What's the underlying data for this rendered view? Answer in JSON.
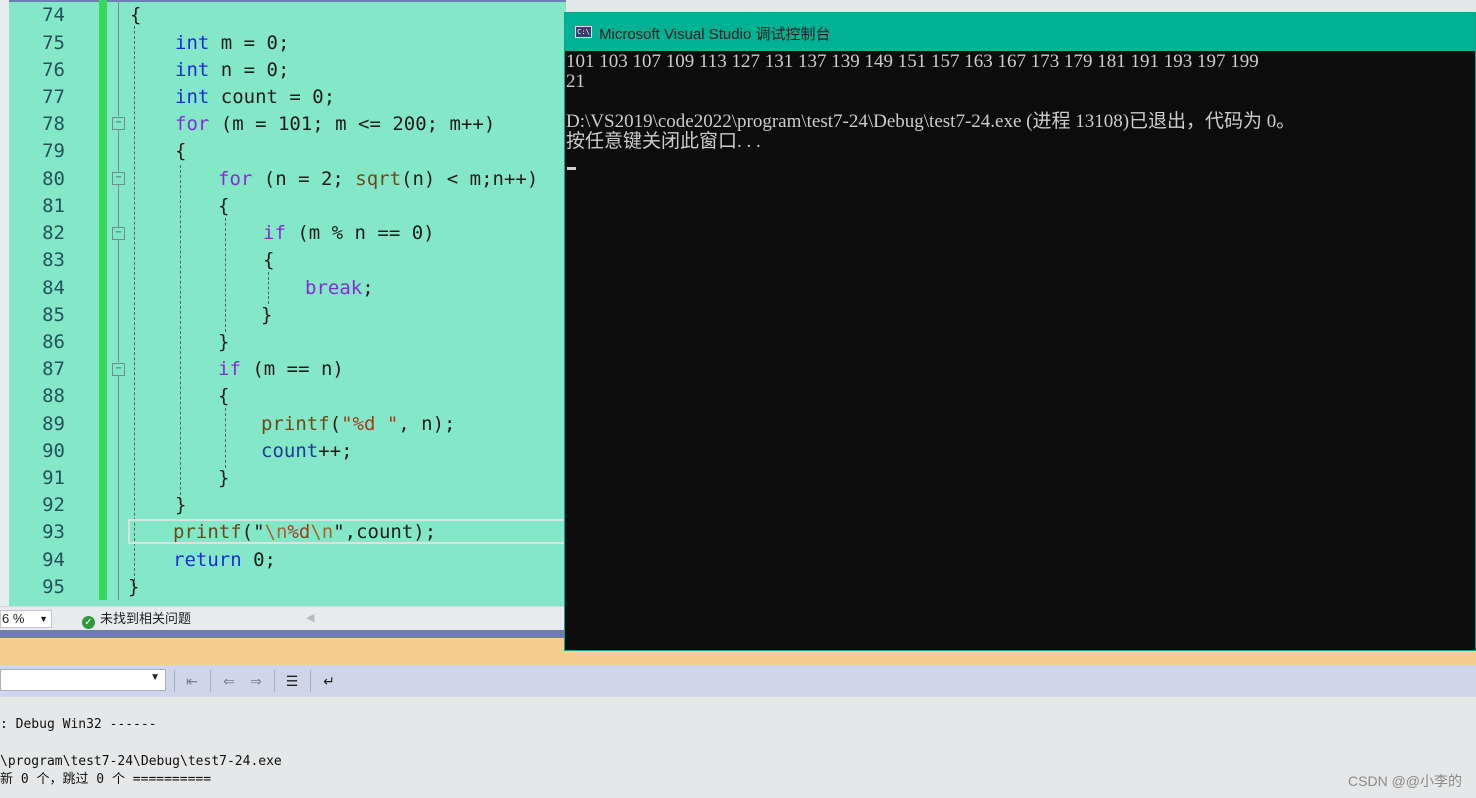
{
  "editor": {
    "line_numbers": [
      "74",
      "75",
      "76",
      "77",
      "78",
      "79",
      "80",
      "81",
      "82",
      "83",
      "84",
      "85",
      "86",
      "87",
      "88",
      "89",
      "90",
      "91",
      "92",
      "93",
      "94",
      "95"
    ],
    "code": {
      "l74": "{",
      "kw_int": "int",
      "l75_rest": " m = 0;",
      "l76_rest": " n = 0;",
      "l77_rest": " count = 0;",
      "kw_for": "for",
      "l78_rest": " (m = 101; m <= 200; m++)",
      "l79": "{",
      "l80_open": " (n = 2; ",
      "fn_sqrt": "sqrt",
      "l80_close": "(n) < m;n++)",
      "l81": "{",
      "kw_if": "if",
      "l82_rest": " (m % n == 0)",
      "l83": "{",
      "kw_break": "break",
      "semi": ";",
      "l85": "}",
      "l86": "}",
      "l87_rest": " (m == n)",
      "l88": "{",
      "fn_printf": "printf",
      "l89_open": "(",
      "l89_str": "\"%d \"",
      "l89_close": ", n);",
      "var_count": "count",
      "l90_rest": "++;",
      "l91": "}",
      "l92": "}",
      "l93_open": "(\"",
      "esc_n1": "\\n",
      "l93_mid": "%d",
      "esc_n2": "\\n",
      "l93_close": "\",count);",
      "kw_return": "return",
      "l94_rest": " 0;",
      "l95": "}"
    },
    "fold_markers": [
      "−",
      "−",
      "−",
      "−"
    ]
  },
  "status_bar": {
    "zoom": "6 %",
    "issues_text": "未找到相关问题",
    "issues_icon": "check-circle-icon"
  },
  "output": {
    "lines": [
      ": Debug Win32 ------",
      "\\program\\test7-24\\Debug\\test7-24.exe",
      "新 0 个，跳过 0 个 =========="
    ]
  },
  "console": {
    "title": "Microsoft Visual Studio 调试控制台",
    "icon_label": "C:\\",
    "lines": [
      "101 103 107 109 113 127 131 137 139 149 151 157 163 167 173 179 181 191 193 197 199",
      "21",
      "",
      "D:\\VS2019\\code2022\\program\\test7-24\\Debug\\test7-24.exe (进程 13108)已退出，代码为 0。",
      "按任意键关闭此窗口. . ."
    ]
  },
  "watermark": "CSDN @@小李的",
  "colors": {
    "editor_bg": "#84e8c8",
    "console_titlebar": "#00b294",
    "console_bg": "#0c0c0c",
    "output_header": "#f6cd8c",
    "change_bar": "#37d85a"
  }
}
